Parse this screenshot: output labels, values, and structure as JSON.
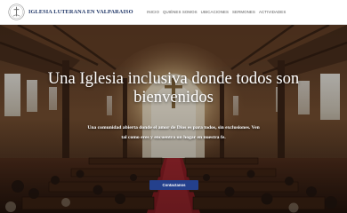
{
  "header": {
    "site_title": "IGLESIA LUTERANA EN VALPARAISO",
    "nav": [
      {
        "label": "INICIO"
      },
      {
        "label": "QUIÉNES SOMOS"
      },
      {
        "label": "UBICACIONES"
      },
      {
        "label": "SERMONES"
      },
      {
        "label": "ACTIVIDADES"
      }
    ]
  },
  "hero": {
    "title": "Una Iglesia inclusiva donde todos son bienvenidos",
    "subtitle": "Una comunidad abierta donde el amor de Dios es para todos, sin exclusiones. Ven tal como eres y encuentra un hogar en nuestra fe.",
    "cta_label": "Contactanos"
  },
  "colors": {
    "brand_title": "#1f3566",
    "cta_background": "#24408c",
    "nav_text": "#5a5a5a"
  },
  "icons": {
    "logo": "church-seal-logo"
  }
}
